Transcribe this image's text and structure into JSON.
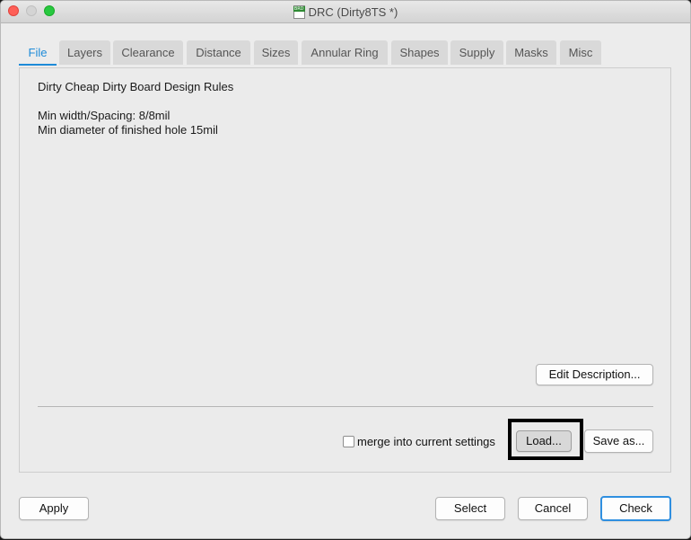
{
  "window": {
    "title": "DRC (Dirty8TS *)",
    "icon": "brd-file-icon",
    "icon_badge": "BRD"
  },
  "tabs": [
    {
      "label": "File",
      "active": true
    },
    {
      "label": "Layers"
    },
    {
      "label": "Clearance"
    },
    {
      "label": "Distance"
    },
    {
      "label": "Sizes"
    },
    {
      "label": "Annular Ring"
    },
    {
      "label": "Shapes"
    },
    {
      "label": "Supply"
    },
    {
      "label": "Masks"
    },
    {
      "label": "Misc"
    }
  ],
  "file_tab": {
    "description": {
      "title": "Dirty Cheap Dirty Board Design Rules",
      "line1": "Min width/Spacing: 8/8mil",
      "line2": "Min diameter of finished hole 15mil"
    },
    "edit_description_label": "Edit Description...",
    "merge_label": "merge into current settings",
    "merge_checked": false,
    "load_label": "Load...",
    "save_as_label": "Save as..."
  },
  "footer": {
    "apply_label": "Apply",
    "select_label": "Select",
    "cancel_label": "Cancel",
    "check_label": "Check"
  },
  "colors": {
    "accent": "#1e8bd8",
    "close": "#fe5f57",
    "maximize": "#28c840",
    "highlight_box": "#000000"
  }
}
